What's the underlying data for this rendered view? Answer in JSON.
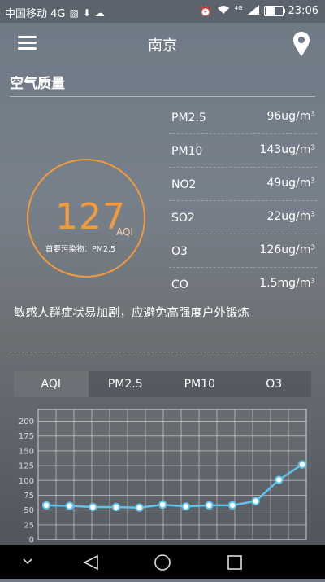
{
  "status_bar": {
    "carrier": "中国移动 4G",
    "net_badge": "4G",
    "time": "23:06",
    "battery_level": 0.55
  },
  "header": {
    "city": "南京"
  },
  "section": {
    "title": "空气质量"
  },
  "aqi": {
    "value": "127",
    "unit": "AQI",
    "primary_label": "首要污染物：",
    "primary_value": "PM2.5",
    "ring_color": "#f39a3a"
  },
  "pollutants": [
    {
      "name": "PM2.5",
      "value": "96ug/m³"
    },
    {
      "name": "PM10",
      "value": "143ug/m³"
    },
    {
      "name": "NO2",
      "value": "49ug/m³"
    },
    {
      "name": "SO2",
      "value": "22ug/m³"
    },
    {
      "name": "O3",
      "value": "126ug/m³"
    },
    {
      "name": "CO",
      "value": "1.5mg/m³"
    }
  ],
  "advice": "敏感人群症状易加剧，应避免高强度户外锻炼",
  "tabs": [
    {
      "label": "AQI",
      "active": true
    },
    {
      "label": "PM2.5",
      "active": false
    },
    {
      "label": "PM10",
      "active": false
    },
    {
      "label": "O3",
      "active": false
    }
  ],
  "chart_data": {
    "type": "line",
    "title": "",
    "xlabel": "",
    "ylabel": "",
    "ylim": [
      0,
      220
    ],
    "yticks": [
      0,
      25,
      50,
      75,
      100,
      125,
      150,
      175,
      200
    ],
    "grid": true,
    "series": [
      {
        "values": [
          58,
          57,
          55,
          55,
          54,
          59,
          56,
          58,
          58,
          65,
          101,
          127
        ]
      }
    ],
    "line_color": "#5ec4ec"
  },
  "nav": {
    "icons": [
      "chevron-down-icon",
      "back-icon",
      "home-icon",
      "recents-icon"
    ]
  }
}
